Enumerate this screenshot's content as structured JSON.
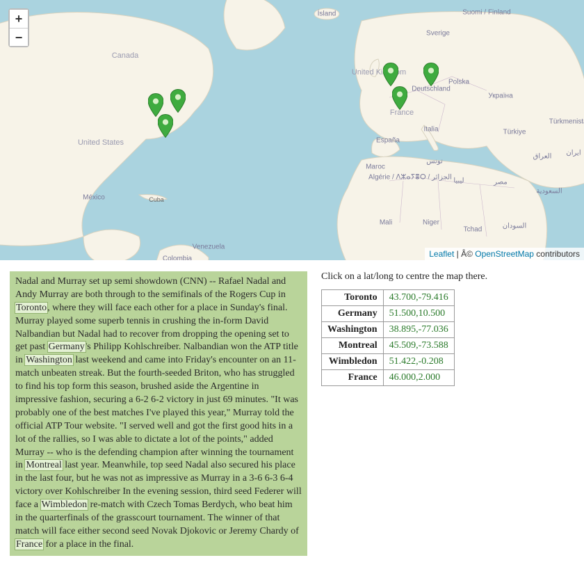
{
  "zoom": {
    "in": "+",
    "out": "−"
  },
  "attribution": {
    "leaflet": "Leaflet",
    "sep": " | Â© ",
    "osm": "OpenStreetMap",
    "tail": " contributors"
  },
  "map_labels": {
    "iceland": "Ísland",
    "suomi": "Suomi / Finland",
    "sverige": "Sverige",
    "uk": "United Kingdom",
    "deutschland": "Deutschland",
    "france": "France",
    "espana": "España",
    "italia": "Italia",
    "polska": "Polska",
    "ukraine": "Україна",
    "turkiye": "Türkiye",
    "maroc": "Maroc",
    "algerie": "Algérie / ⴷⵣⴰⵢⴻⵔ / الجزائر",
    "tunis": "تونس",
    "libya": "ليبيا",
    "egypt": "مصر",
    "saudi": "السعودية",
    "iraq": "العراق",
    "iran": "ایران",
    "turkmen": "Türkmenistan",
    "mali": "Mali",
    "niger": "Niger",
    "chad": "Tchad",
    "sudan": "السودان",
    "canada": "Canada",
    "usa": "United States",
    "mexico": "México",
    "cuba": "Cuba",
    "colombia": "Colombia",
    "venezuela": "Venezuela"
  },
  "article": {
    "p1a": "Nadal and Murray set up semi showdown (CNN) -- Rafael Nadal and Andy Murray are both through to the semifinals of the Rogers Cup in ",
    "hl_toronto": "Toronto",
    "p1b": ", where they will face each other for a place in Sunday's final. Murray played some superb tennis in crushing the in-form David Nalbandian but Nadal had to recover from dropping the opening set to get past ",
    "hl_germany": "Germany",
    "p1c": "'s Philipp Kohlschreiber. Nalbandian won the ATP title in ",
    "hl_washington": "Washington",
    "p1d": " last weekend and came into Friday's encounter on an 11-match unbeaten streak. But the fourth-seeded Briton, who has struggled to find his top form this season, brushed aside the Argentine in impressive fashion, securing a 6-2 6-2 victory in just 69 minutes. \"It was probably one of the best matches I've played this year,\" Murray told the official ATP Tour website. \"I served well and got the first good hits in a lot of the rallies, so I was able to dictate a lot of the points,\" added Murray -- who is the defending champion after winning the tournament in ",
    "hl_montreal": "Montreal",
    "p1e": " last year. Meanwhile, top seed Nadal also secured his place in the last four, but he was not as impressive as Murray in a 3-6 6-3 6-4 victory over Kohlschreiber In the evening session, third seed Federer will face a ",
    "hl_wimbledon": "Wimbledon",
    "p1f": " re-match with Czech Tomas Berdych, who beat him in the quarterfinals of the grasscourt tournament. The winner of that match will face either second seed Novak Djokovic or Jeremy Chardy of ",
    "hl_france": "France",
    "p1g": " for a place in the final."
  },
  "instruction": "Click on a lat/long to centre the map there.",
  "coords": [
    {
      "name": "Toronto",
      "ll": "43.700,-79.416"
    },
    {
      "name": "Germany",
      "ll": "51.500,10.500"
    },
    {
      "name": "Washington",
      "ll": "38.895,-77.036"
    },
    {
      "name": "Montreal",
      "ll": "45.509,-73.588"
    },
    {
      "name": "Wimbledon",
      "ll": "51.422,-0.208"
    },
    {
      "name": "France",
      "ll": "46.000,2.000"
    }
  ]
}
